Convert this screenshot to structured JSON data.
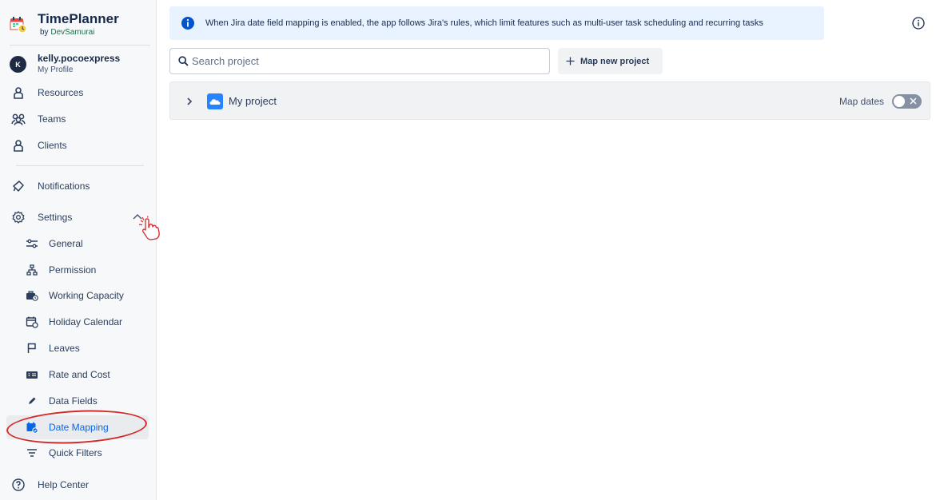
{
  "brand": {
    "title": "TimePlanner",
    "by": "by ",
    "vendor": "DevSamurai"
  },
  "profile": {
    "initial": "K",
    "name": "kelly.pocoexpress",
    "subtitle": "My Profile"
  },
  "nav": {
    "resources": "Resources",
    "teams": "Teams",
    "clients": "Clients",
    "notifications": "Notifications",
    "settings": "Settings",
    "help": "Help Center"
  },
  "settings_items": {
    "general": "General",
    "permission": "Permission",
    "working_capacity": "Working Capacity",
    "holiday_calendar": "Holiday Calendar",
    "leaves": "Leaves",
    "rate_and_cost": "Rate and Cost",
    "data_fields": "Data Fields",
    "date_mapping": "Date Mapping",
    "quick_filters": "Quick Filters"
  },
  "banner": {
    "text": "When Jira date field mapping is enabled, the app follows Jira's rules, which limit features such as multi-user task scheduling and recurring tasks"
  },
  "search": {
    "placeholder": "Search project",
    "value": ""
  },
  "map_button": {
    "label": "Map new project"
  },
  "projects": [
    {
      "name": "My project",
      "map_dates_label": "Map dates",
      "map_dates_enabled": false
    }
  ],
  "colors": {
    "accent": "#0c66e4",
    "banner_bg": "#e9f2ff",
    "annotation": "#d32a2a",
    "toggle_off": "#8590a2"
  },
  "icons": {
    "active_item": "calendar-check-icon",
    "annotation": "tap-hand-icon"
  }
}
